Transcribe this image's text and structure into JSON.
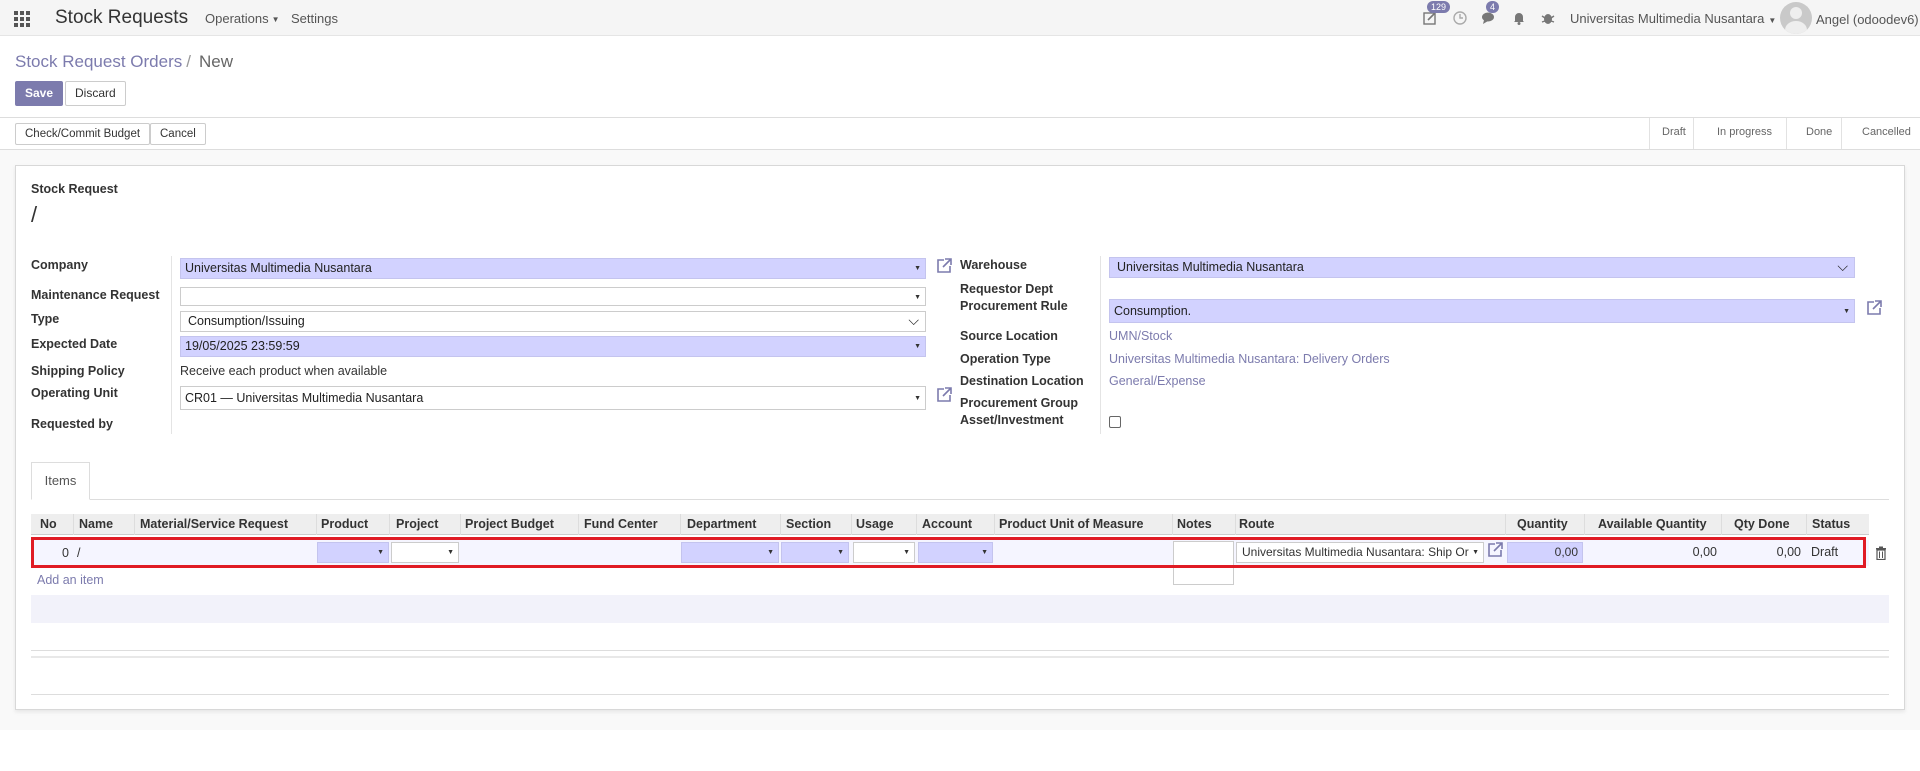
{
  "navbar": {
    "brand": "Stock Requests",
    "menus": [
      "Operations",
      "Settings"
    ],
    "activity_count": "129",
    "messages_count": "4",
    "company": "Universitas Multimedia Nusantara",
    "user": "Angel (odoodev6)"
  },
  "breadcrumb": {
    "parent": "Stock Request Orders",
    "separator": "/",
    "current": "New"
  },
  "buttons": {
    "save": "Save",
    "discard": "Discard",
    "check_budget": "Check/Commit Budget",
    "cancel": "Cancel"
  },
  "stages": [
    "Draft",
    "In progress",
    "Done",
    "Cancelled"
  ],
  "form": {
    "title_label": "Stock Request",
    "title_value": "/",
    "left": {
      "company_label": "Company",
      "company_value": "Universitas Multimedia Nusantara",
      "maintenance_label": "Maintenance Request",
      "maintenance_value": "",
      "type_label": "Type",
      "type_value": "Consumption/Issuing",
      "expected_label": "Expected Date",
      "expected_value": "19/05/2025 23:59:59",
      "shipping_label": "Shipping Policy",
      "shipping_value": "Receive each product when available",
      "operating_label": "Operating Unit",
      "operating_value": "CR01 — Universitas Multimedia Nusantara",
      "requested_label": "Requested by"
    },
    "right": {
      "warehouse_label": "Warehouse",
      "warehouse_value": "Universitas Multimedia Nusantara",
      "requestor_label": "Requestor Dept",
      "procurement_rule_label": "Procurement Rule",
      "procurement_rule_value": "Consumption.",
      "source_label": "Source Location",
      "source_value": "UMN/Stock",
      "operation_label": "Operation Type",
      "operation_value": "Universitas Multimedia Nusantara: Delivery Orders",
      "destination_label": "Destination Location",
      "destination_value": "General/Expense",
      "procurement_group_label": "Procurement Group",
      "asset_label": "Asset/Investment"
    }
  },
  "tabs": {
    "items": "Items"
  },
  "table": {
    "headers": [
      "No",
      "Name",
      "Material/Service Request",
      "Product",
      "Project",
      "Project Budget",
      "Fund Center",
      "Department",
      "Section",
      "Usage",
      "Account",
      "Product Unit of Measure",
      "Notes",
      "Route",
      "Quantity",
      "Available Quantity",
      "Qty Done",
      "Status"
    ],
    "row": {
      "no": "0",
      "name": "/",
      "route": "Universitas Multimedia Nusantara: Ship Or",
      "quantity": "0,00",
      "available": "0,00",
      "qty_done": "0,00",
      "status": "Draft"
    },
    "add_item": "Add an item"
  }
}
